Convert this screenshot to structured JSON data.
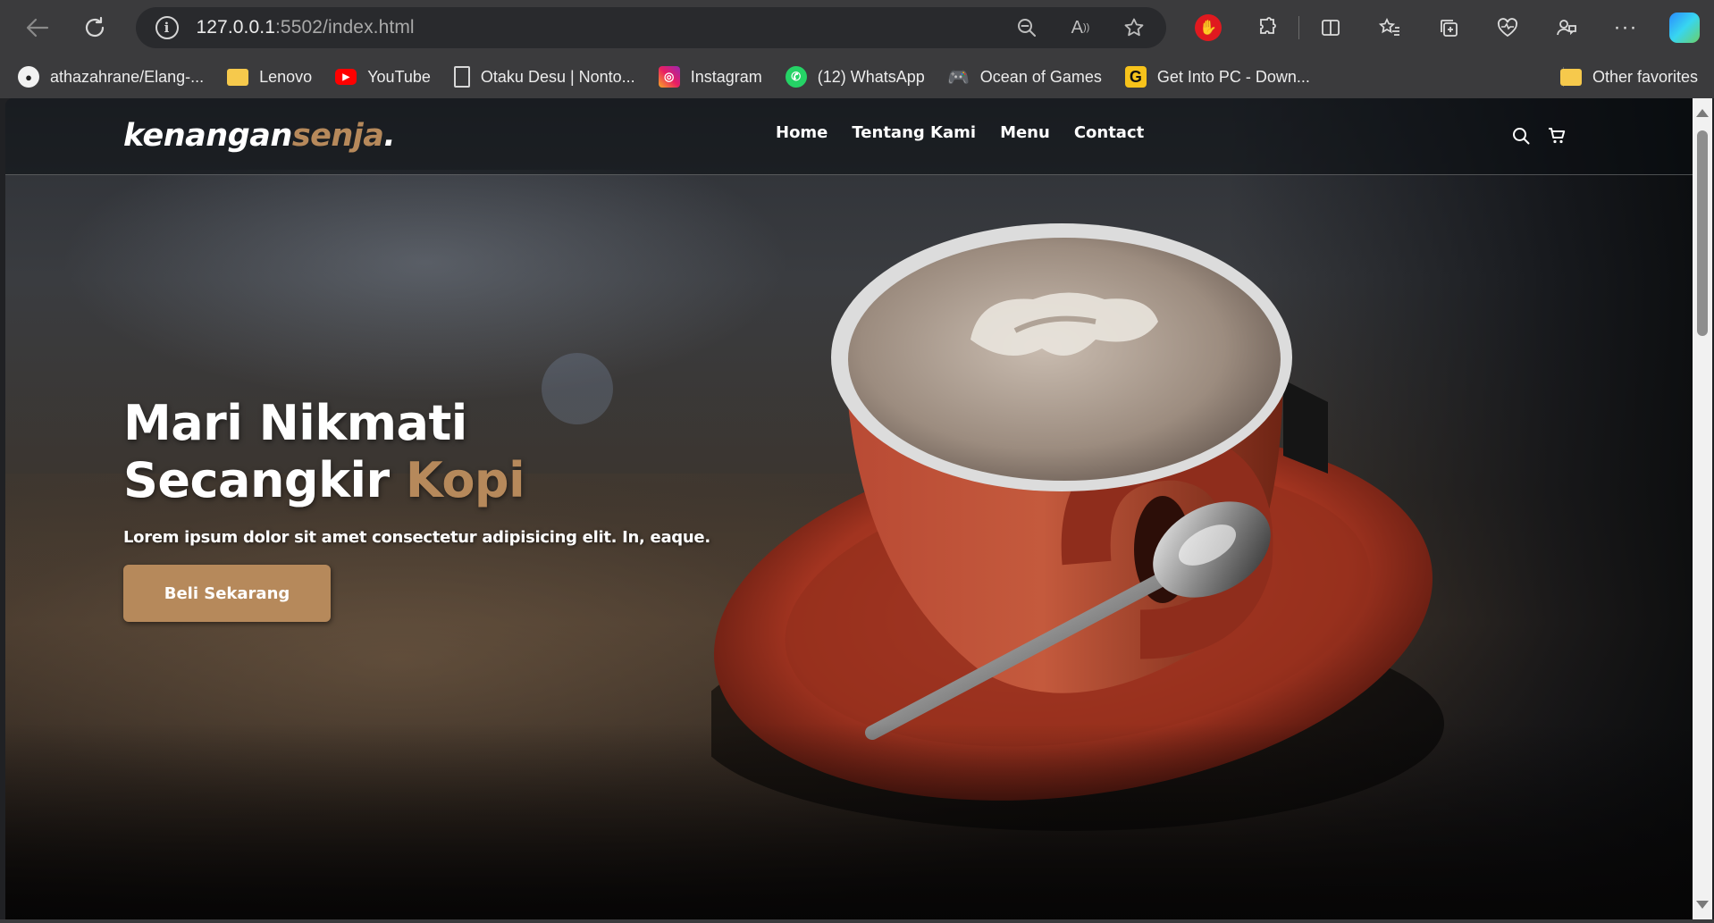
{
  "browser": {
    "url_host": "127.0.0.1",
    "url_rest": ":5502/index.html",
    "bookmarks": [
      {
        "label": "athazahrane/Elang-...",
        "icon": "github-icon"
      },
      {
        "label": "Lenovo",
        "icon": "folder-icon"
      },
      {
        "label": "YouTube",
        "icon": "youtube-icon"
      },
      {
        "label": "Otaku Desu | Nonto...",
        "icon": "page-icon"
      },
      {
        "label": "Instagram",
        "icon": "instagram-icon"
      },
      {
        "label": "(12) WhatsApp",
        "icon": "whatsapp-icon"
      },
      {
        "label": "Ocean of Games",
        "icon": "gamepad-icon"
      },
      {
        "label": "Get Into PC - Down...",
        "icon": "getintopc-icon"
      }
    ],
    "other_favorites": "Other favorites"
  },
  "site": {
    "logo_main": "kenangan",
    "logo_accent": "senja",
    "logo_dot": ".",
    "nav": [
      "Home",
      "Tentang Kami",
      "Menu",
      "Contact"
    ],
    "hero_title_line1": "Mari Nikmati",
    "hero_title_line2": "Secangkir ",
    "hero_title_accent": "Kopi",
    "hero_text": "Lorem ipsum dolor sit amet consectetur adipisicing elit. In, eaque.",
    "cta": "Beli Sekarang"
  },
  "colors": {
    "accent": "#b6895b",
    "chrome": "#3b3b3d",
    "cup": "#c0392b"
  }
}
